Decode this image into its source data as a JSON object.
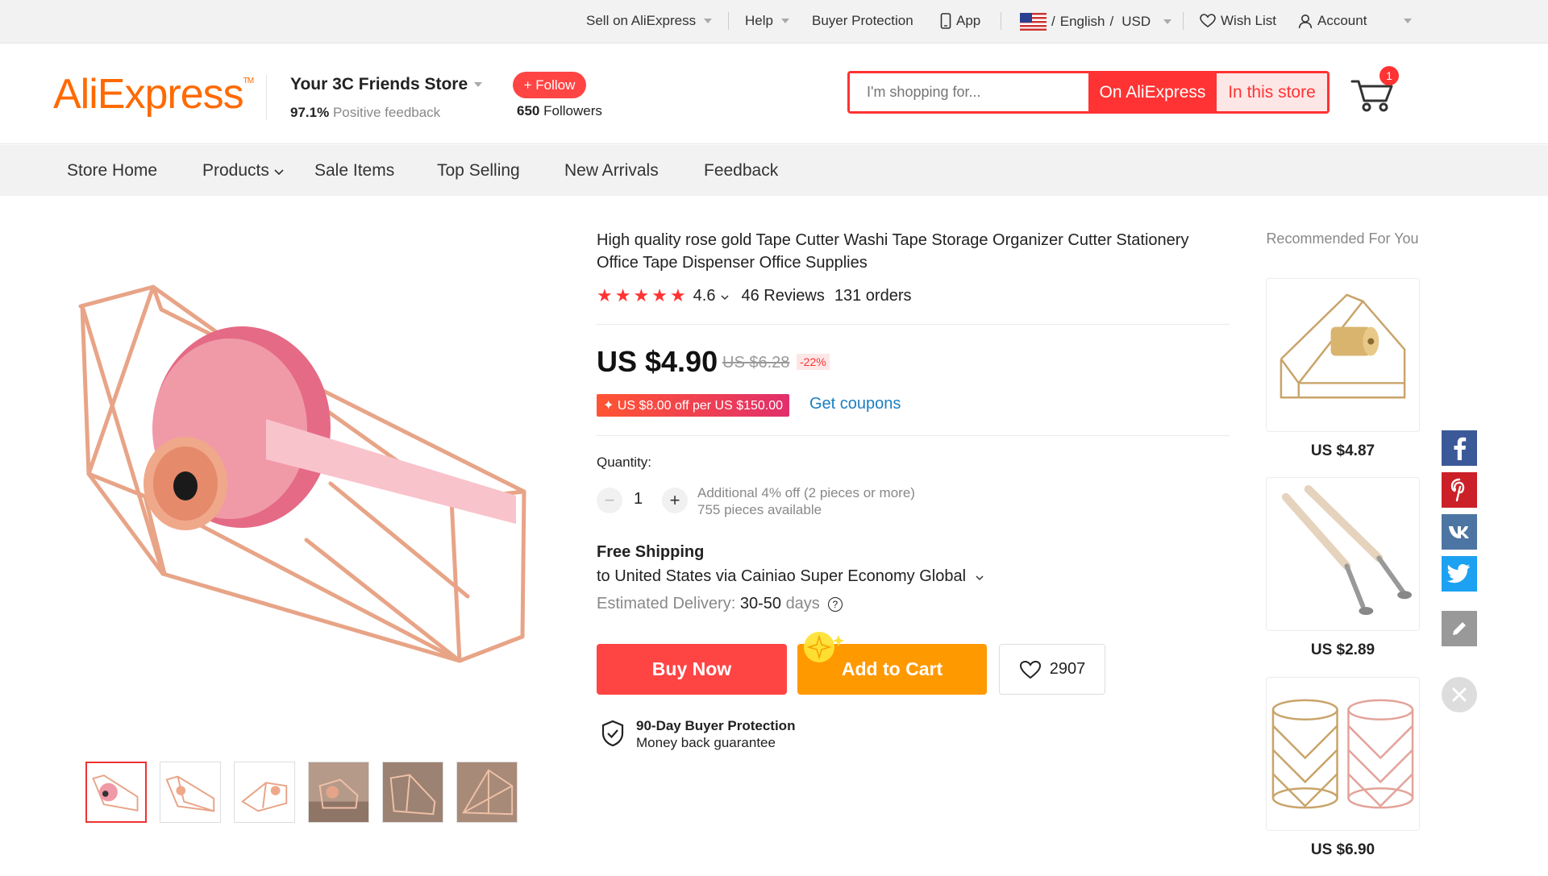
{
  "topbar": {
    "sell": "Sell on AliExpress",
    "help": "Help",
    "protection": "Buyer Protection",
    "app": "App",
    "lang_sep1": "/",
    "language": "English",
    "lang_sep2": "/",
    "currency": "USD",
    "wishlist": "Wish List",
    "account": "Account"
  },
  "header": {
    "logo": "AliExpress",
    "logo_tm": "TM",
    "store_name": "Your 3C Friends Store",
    "feedback_pct": "97.1%",
    "feedback_label": "Positive feedback",
    "follow_label": "+ Follow",
    "followers_count": "650",
    "followers_label": "Followers",
    "search_placeholder": "I'm shopping for...",
    "search_all": "On AliExpress",
    "search_store": "In this store",
    "cart_count": "1"
  },
  "nav": {
    "items": [
      "Store Home",
      "Products",
      "Sale Items",
      "Top Selling",
      "New Arrivals",
      "Feedback"
    ]
  },
  "product": {
    "title": "High quality rose gold Tape Cutter Washi Tape Storage Organizer Cutter Stationery Office Tape Dispenser Office Supplies",
    "rating": "4.6",
    "reviews": "46 Reviews",
    "orders": "131 orders",
    "stars": 5,
    "price": "US $4.90",
    "old_price": "US $6.28",
    "discount": "-22%",
    "coupon": "US $8.00 off per US $150.00",
    "coupon_icon": "✦",
    "get_coupons": "Get coupons",
    "quantity_label": "Quantity:",
    "quantity": "1",
    "qty_minus": "−",
    "qty_plus": "+",
    "qty_offer": "Additional 4% off (2 pieces or more)",
    "qty_available": "755 pieces available",
    "shipping_title": "Free Shipping",
    "shipping_to": "to United States via Cainiao Super Economy Global",
    "delivery_label": "Estimated Delivery:",
    "delivery_range": "30-50",
    "delivery_unit": "days",
    "delivery_help": "?",
    "buy_now": "Buy Now",
    "add_to_cart": "Add to Cart",
    "wish_count": "2907",
    "protection_title": "90-Day Buyer Protection",
    "protection_sub": "Money back guarantee"
  },
  "recommended": {
    "title": "Recommended For You",
    "items": [
      {
        "price": "US $4.87"
      },
      {
        "price": "US $2.89"
      },
      {
        "price": "US $6.90"
      }
    ]
  },
  "colors": {
    "brand_orange": "#ff6a00",
    "accent_red": "#ff3333",
    "cart_orange": "#ff9900",
    "link_blue": "#1a7fc1"
  }
}
